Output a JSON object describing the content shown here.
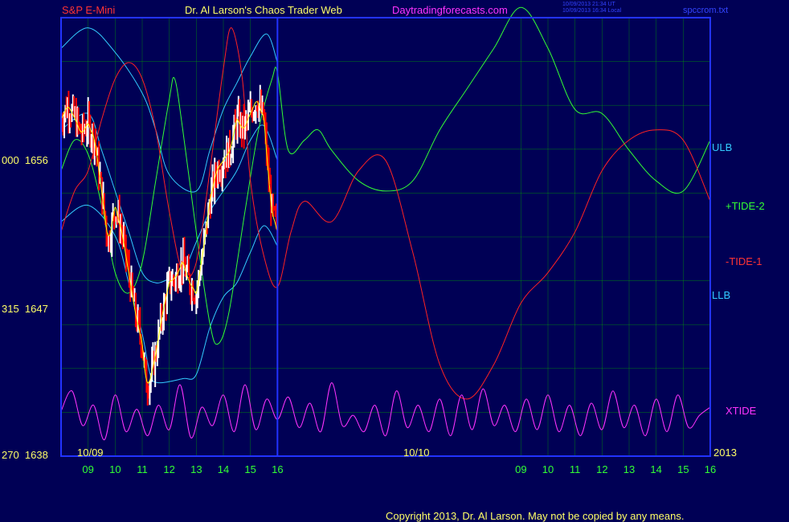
{
  "header": {
    "symbol": "S&P E-Mini",
    "title": "Dr. Al Larson's Chaos Trader Web",
    "site": "Daytradingforecasts.com",
    "stamp_ut": "10/09/2013 21:34 UT",
    "stamp_local": "10/09/2013 16:34 Local",
    "file": "spccrom.txt"
  },
  "footer": {
    "copyright": "Copyright 2013, Dr. Al Larson. May not be copied by any means."
  },
  "chart_data": {
    "type": "line",
    "title": "",
    "xlabel": "",
    "ylabel": "",
    "ylim": [
      1638,
      1659.5
    ],
    "y_ticks": [
      {
        "value": 1656,
        "label": "000  1656"
      },
      {
        "value": 1647,
        "label": "315  1647"
      },
      {
        "value": 1638,
        "label": "270  1638"
      }
    ],
    "date_labels": [
      "10/09",
      "10/10",
      "2013"
    ],
    "x_ticks": [
      "09",
      "10",
      "11",
      "12",
      "13",
      "14",
      "15",
      "16",
      "09",
      "10",
      "11",
      "12",
      "13",
      "14",
      "15",
      "16"
    ],
    "x_tick_hours": [
      9,
      10,
      11,
      12,
      13,
      14,
      15,
      16,
      25,
      26,
      27,
      28,
      29,
      30,
      31,
      32
    ],
    "xlim": [
      8,
      32
    ],
    "now_hour": 16,
    "colors": {
      "price": "#ffffff",
      "down": "#ff0000",
      "ma": "#ffff00",
      "band": "#33ccff",
      "tide2": "#33ff33",
      "tide1": "#ff2222",
      "xtide": "#ff33ff",
      "grid": "#00aa00",
      "frame": "#2233ff"
    },
    "price": [
      [
        8.0,
        1654.5
      ],
      [
        8.25,
        1655.2
      ],
      [
        8.5,
        1654.6
      ],
      [
        8.75,
        1653.8
      ],
      [
        9.0,
        1654.3
      ],
      [
        9.25,
        1653.5
      ],
      [
        9.5,
        1651.0
      ],
      [
        9.75,
        1648.5
      ],
      [
        10.0,
        1650.2
      ],
      [
        10.25,
        1649.0
      ],
      [
        10.5,
        1647.0
      ],
      [
        10.75,
        1645.0
      ],
      [
        11.0,
        1643.5
      ],
      [
        11.15,
        1641.5
      ],
      [
        11.3,
        1641.8
      ],
      [
        11.5,
        1643.0
      ],
      [
        11.75,
        1645.0
      ],
      [
        12.0,
        1646.5
      ],
      [
        12.25,
        1646.8
      ],
      [
        12.5,
        1647.5
      ],
      [
        12.75,
        1646.5
      ],
      [
        13.0,
        1646.0
      ],
      [
        13.25,
        1648.0
      ],
      [
        13.5,
        1650.5
      ],
      [
        13.75,
        1652.0
      ],
      [
        14.0,
        1652.5
      ],
      [
        14.25,
        1653.0
      ],
      [
        14.5,
        1654.5
      ],
      [
        14.75,
        1654.0
      ],
      [
        15.0,
        1654.8
      ],
      [
        15.25,
        1655.5
      ],
      [
        15.5,
        1654.5
      ],
      [
        15.65,
        1652.0
      ],
      [
        15.8,
        1650.0
      ],
      [
        16.0,
        1649.0
      ]
    ],
    "series": [
      {
        "name": "ULB",
        "values": [
          [
            8.0,
            1658.0
          ],
          [
            9.0,
            1659.0
          ],
          [
            10.0,
            1657.8
          ],
          [
            11.0,
            1655.8
          ],
          [
            11.5,
            1654.0
          ],
          [
            12.0,
            1651.8
          ],
          [
            13.0,
            1651.0
          ],
          [
            13.5,
            1653.0
          ],
          [
            14.0,
            1655.0
          ],
          [
            14.5,
            1656.3
          ],
          [
            15.0,
            1657.6
          ],
          [
            15.6,
            1658.7
          ],
          [
            16.0,
            1657.3
          ]
        ]
      },
      {
        "name": "mid",
        "values": [
          [
            8.0,
            1654.0
          ],
          [
            9.0,
            1654.8
          ],
          [
            9.5,
            1653.0
          ],
          [
            10.0,
            1651.0
          ],
          [
            10.5,
            1649.0
          ],
          [
            11.0,
            1647.0
          ],
          [
            11.5,
            1646.5
          ],
          [
            12.0,
            1646.7
          ],
          [
            12.5,
            1647.0
          ],
          [
            13.0,
            1648.5
          ],
          [
            13.5,
            1650.0
          ],
          [
            14.0,
            1651.0
          ],
          [
            14.5,
            1652.0
          ],
          [
            15.0,
            1653.5
          ],
          [
            15.5,
            1654.2
          ],
          [
            16.0,
            1652.5
          ]
        ]
      },
      {
        "name": "LLB",
        "values": [
          [
            8.0,
            1649.5
          ],
          [
            9.0,
            1650.3
          ],
          [
            10.0,
            1648.8
          ],
          [
            10.5,
            1646.5
          ],
          [
            11.0,
            1644.0
          ],
          [
            11.3,
            1642.0
          ],
          [
            11.6,
            1641.6
          ],
          [
            12.5,
            1641.8
          ],
          [
            13.0,
            1642.0
          ],
          [
            13.5,
            1644.3
          ],
          [
            14.0,
            1645.8
          ],
          [
            14.5,
            1646.5
          ],
          [
            15.0,
            1648.0
          ],
          [
            15.5,
            1649.3
          ],
          [
            16.0,
            1648.3
          ]
        ]
      },
      {
        "name": "+TIDE-2",
        "values": [
          [
            8.0,
            1652.0
          ],
          [
            8.5,
            1653.5
          ],
          [
            9.0,
            1652.8
          ],
          [
            9.5,
            1650.3
          ],
          [
            10.0,
            1647.0
          ],
          [
            10.5,
            1646.0
          ],
          [
            11.0,
            1647.5
          ],
          [
            11.5,
            1651.5
          ],
          [
            12.0,
            1655.5
          ],
          [
            12.2,
            1656.5
          ],
          [
            12.5,
            1654.0
          ],
          [
            13.0,
            1649.0
          ],
          [
            13.5,
            1644.5
          ],
          [
            13.8,
            1643.5
          ],
          [
            14.2,
            1645.0
          ],
          [
            14.8,
            1650.0
          ],
          [
            15.3,
            1654.0
          ],
          [
            15.8,
            1656.5
          ],
          [
            16.0,
            1656.8
          ],
          [
            16.4,
            1653.0
          ],
          [
            17.0,
            1653.5
          ],
          [
            17.5,
            1654.0
          ],
          [
            18.0,
            1653.0
          ],
          [
            19.0,
            1651.5
          ],
          [
            20.0,
            1651.0
          ],
          [
            21.0,
            1651.5
          ],
          [
            22.0,
            1654.0
          ],
          [
            23.0,
            1656.0
          ],
          [
            24.0,
            1658.0
          ],
          [
            25.0,
            1660.0
          ],
          [
            26.0,
            1658.0
          ],
          [
            27.0,
            1655.0
          ],
          [
            28.0,
            1654.8
          ],
          [
            29.0,
            1653.0
          ],
          [
            30.0,
            1651.5
          ],
          [
            31.0,
            1651.0
          ],
          [
            32.0,
            1653.5
          ]
        ]
      },
      {
        "name": "-TIDE-1",
        "values": [
          [
            8.0,
            1649.0
          ],
          [
            8.5,
            1651.0
          ],
          [
            9.0,
            1652.0
          ],
          [
            9.5,
            1654.5
          ],
          [
            10.0,
            1656.5
          ],
          [
            10.5,
            1657.3
          ],
          [
            11.0,
            1656.5
          ],
          [
            11.5,
            1654.0
          ],
          [
            12.0,
            1650.0
          ],
          [
            12.5,
            1647.0
          ],
          [
            13.0,
            1647.5
          ],
          [
            13.5,
            1652.0
          ],
          [
            14.0,
            1657.0
          ],
          [
            14.3,
            1659.0
          ],
          [
            14.7,
            1656.5
          ],
          [
            15.0,
            1651.5
          ],
          [
            15.5,
            1647.8
          ],
          [
            16.0,
            1646.3
          ],
          [
            16.5,
            1649.0
          ],
          [
            17.0,
            1650.5
          ],
          [
            18.0,
            1649.5
          ],
          [
            19.0,
            1652.0
          ],
          [
            20.0,
            1652.5
          ],
          [
            21.0,
            1648.0
          ],
          [
            22.0,
            1642.5
          ],
          [
            23.0,
            1640.8
          ],
          [
            24.0,
            1642.5
          ],
          [
            25.0,
            1645.5
          ],
          [
            26.0,
            1647.0
          ],
          [
            27.0,
            1649.0
          ],
          [
            28.0,
            1652.0
          ],
          [
            29.0,
            1653.5
          ],
          [
            30.0,
            1654.0
          ],
          [
            31.0,
            1653.5
          ],
          [
            32.0,
            1650.5
          ]
        ]
      }
    ],
    "xtide": {
      "name": "XTIDE",
      "ymin": 1638.6,
      "ymax": 1641.8,
      "values": [
        [
          8.0,
          1640.2
        ],
        [
          8.4,
          1641.2
        ],
        [
          8.8,
          1639.5
        ],
        [
          9.2,
          1640.5
        ],
        [
          9.6,
          1638.8
        ],
        [
          10.0,
          1641.0
        ],
        [
          10.4,
          1639.2
        ],
        [
          10.8,
          1640.3
        ],
        [
          11.2,
          1639.0
        ],
        [
          11.6,
          1640.5
        ],
        [
          12.0,
          1639.3
        ],
        [
          12.4,
          1641.5
        ],
        [
          12.8,
          1638.9
        ],
        [
          13.2,
          1640.4
        ],
        [
          13.6,
          1639.5
        ],
        [
          14.0,
          1641.0
        ],
        [
          14.4,
          1639.2
        ],
        [
          14.8,
          1641.5
        ],
        [
          15.2,
          1639.3
        ],
        [
          15.6,
          1640.8
        ],
        [
          16.0,
          1639.8
        ],
        [
          16.4,
          1640.9
        ],
        [
          16.8,
          1639.4
        ],
        [
          17.2,
          1640.6
        ],
        [
          17.6,
          1639.2
        ],
        [
          18.0,
          1641.6
        ],
        [
          18.4,
          1639.5
        ],
        [
          18.8,
          1640.0
        ],
        [
          19.2,
          1639.2
        ],
        [
          19.6,
          1640.5
        ],
        [
          20.0,
          1639.0
        ],
        [
          20.4,
          1641.2
        ],
        [
          20.8,
          1639.4
        ],
        [
          21.2,
          1640.5
        ],
        [
          21.6,
          1639.2
        ],
        [
          22.0,
          1640.8
        ],
        [
          22.4,
          1639.0
        ],
        [
          22.8,
          1641.0
        ],
        [
          23.2,
          1639.3
        ],
        [
          23.6,
          1641.3
        ],
        [
          24.0,
          1639.5
        ],
        [
          24.4,
          1640.5
        ],
        [
          24.8,
          1639.2
        ],
        [
          25.2,
          1640.8
        ],
        [
          25.6,
          1639.3
        ],
        [
          26.0,
          1641.0
        ],
        [
          26.4,
          1639.2
        ],
        [
          26.8,
          1640.5
        ],
        [
          27.2,
          1639.0
        ],
        [
          27.6,
          1640.6
        ],
        [
          28.0,
          1639.3
        ],
        [
          28.4,
          1641.2
        ],
        [
          28.8,
          1639.4
        ],
        [
          29.2,
          1640.5
        ],
        [
          29.6,
          1639.0
        ],
        [
          30.0,
          1640.8
        ],
        [
          30.4,
          1639.2
        ],
        [
          30.8,
          1641.0
        ],
        [
          31.2,
          1639.4
        ],
        [
          31.6,
          1640.0
        ],
        [
          32.0,
          1640.4
        ]
      ]
    },
    "right_labels": [
      "ULB",
      "+TIDE-2",
      "-TIDE-1",
      "LLB",
      "XTIDE"
    ]
  }
}
